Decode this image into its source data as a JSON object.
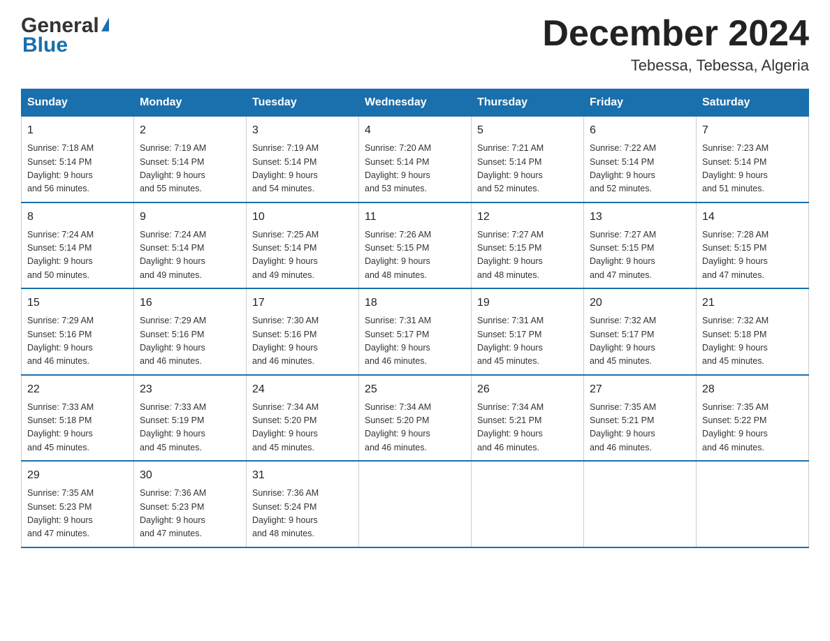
{
  "header": {
    "logo_general": "General",
    "logo_blue": "Blue",
    "month_title": "December 2024",
    "location": "Tebessa, Tebessa, Algeria"
  },
  "columns": [
    "Sunday",
    "Monday",
    "Tuesday",
    "Wednesday",
    "Thursday",
    "Friday",
    "Saturday"
  ],
  "weeks": [
    [
      {
        "day": "1",
        "sunrise": "7:18 AM",
        "sunset": "5:14 PM",
        "daylight": "9 hours and 56 minutes."
      },
      {
        "day": "2",
        "sunrise": "7:19 AM",
        "sunset": "5:14 PM",
        "daylight": "9 hours and 55 minutes."
      },
      {
        "day": "3",
        "sunrise": "7:19 AM",
        "sunset": "5:14 PM",
        "daylight": "9 hours and 54 minutes."
      },
      {
        "day": "4",
        "sunrise": "7:20 AM",
        "sunset": "5:14 PM",
        "daylight": "9 hours and 53 minutes."
      },
      {
        "day": "5",
        "sunrise": "7:21 AM",
        "sunset": "5:14 PM",
        "daylight": "9 hours and 52 minutes."
      },
      {
        "day": "6",
        "sunrise": "7:22 AM",
        "sunset": "5:14 PM",
        "daylight": "9 hours and 52 minutes."
      },
      {
        "day": "7",
        "sunrise": "7:23 AM",
        "sunset": "5:14 PM",
        "daylight": "9 hours and 51 minutes."
      }
    ],
    [
      {
        "day": "8",
        "sunrise": "7:24 AM",
        "sunset": "5:14 PM",
        "daylight": "9 hours and 50 minutes."
      },
      {
        "day": "9",
        "sunrise": "7:24 AM",
        "sunset": "5:14 PM",
        "daylight": "9 hours and 49 minutes."
      },
      {
        "day": "10",
        "sunrise": "7:25 AM",
        "sunset": "5:14 PM",
        "daylight": "9 hours and 49 minutes."
      },
      {
        "day": "11",
        "sunrise": "7:26 AM",
        "sunset": "5:15 PM",
        "daylight": "9 hours and 48 minutes."
      },
      {
        "day": "12",
        "sunrise": "7:27 AM",
        "sunset": "5:15 PM",
        "daylight": "9 hours and 48 minutes."
      },
      {
        "day": "13",
        "sunrise": "7:27 AM",
        "sunset": "5:15 PM",
        "daylight": "9 hours and 47 minutes."
      },
      {
        "day": "14",
        "sunrise": "7:28 AM",
        "sunset": "5:15 PM",
        "daylight": "9 hours and 47 minutes."
      }
    ],
    [
      {
        "day": "15",
        "sunrise": "7:29 AM",
        "sunset": "5:16 PM",
        "daylight": "9 hours and 46 minutes."
      },
      {
        "day": "16",
        "sunrise": "7:29 AM",
        "sunset": "5:16 PM",
        "daylight": "9 hours and 46 minutes."
      },
      {
        "day": "17",
        "sunrise": "7:30 AM",
        "sunset": "5:16 PM",
        "daylight": "9 hours and 46 minutes."
      },
      {
        "day": "18",
        "sunrise": "7:31 AM",
        "sunset": "5:17 PM",
        "daylight": "9 hours and 46 minutes."
      },
      {
        "day": "19",
        "sunrise": "7:31 AM",
        "sunset": "5:17 PM",
        "daylight": "9 hours and 45 minutes."
      },
      {
        "day": "20",
        "sunrise": "7:32 AM",
        "sunset": "5:17 PM",
        "daylight": "9 hours and 45 minutes."
      },
      {
        "day": "21",
        "sunrise": "7:32 AM",
        "sunset": "5:18 PM",
        "daylight": "9 hours and 45 minutes."
      }
    ],
    [
      {
        "day": "22",
        "sunrise": "7:33 AM",
        "sunset": "5:18 PM",
        "daylight": "9 hours and 45 minutes."
      },
      {
        "day": "23",
        "sunrise": "7:33 AM",
        "sunset": "5:19 PM",
        "daylight": "9 hours and 45 minutes."
      },
      {
        "day": "24",
        "sunrise": "7:34 AM",
        "sunset": "5:20 PM",
        "daylight": "9 hours and 45 minutes."
      },
      {
        "day": "25",
        "sunrise": "7:34 AM",
        "sunset": "5:20 PM",
        "daylight": "9 hours and 46 minutes."
      },
      {
        "day": "26",
        "sunrise": "7:34 AM",
        "sunset": "5:21 PM",
        "daylight": "9 hours and 46 minutes."
      },
      {
        "day": "27",
        "sunrise": "7:35 AM",
        "sunset": "5:21 PM",
        "daylight": "9 hours and 46 minutes."
      },
      {
        "day": "28",
        "sunrise": "7:35 AM",
        "sunset": "5:22 PM",
        "daylight": "9 hours and 46 minutes."
      }
    ],
    [
      {
        "day": "29",
        "sunrise": "7:35 AM",
        "sunset": "5:23 PM",
        "daylight": "9 hours and 47 minutes."
      },
      {
        "day": "30",
        "sunrise": "7:36 AM",
        "sunset": "5:23 PM",
        "daylight": "9 hours and 47 minutes."
      },
      {
        "day": "31",
        "sunrise": "7:36 AM",
        "sunset": "5:24 PM",
        "daylight": "9 hours and 48 minutes."
      },
      null,
      null,
      null,
      null
    ]
  ],
  "labels": {
    "sunrise_prefix": "Sunrise: ",
    "sunset_prefix": "Sunset: ",
    "daylight_prefix": "Daylight: "
  }
}
